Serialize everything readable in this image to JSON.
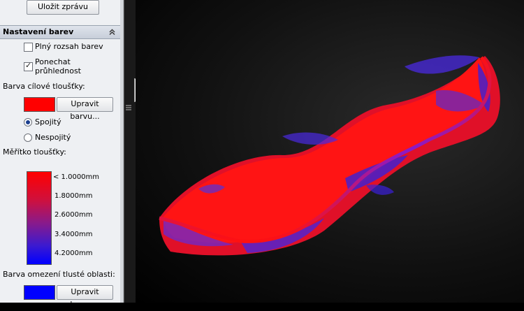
{
  "top_button": {
    "label": "Uložit zprávu"
  },
  "section": {
    "title": "Nastavení barev"
  },
  "options": {
    "full_range": {
      "label": "Plný rozsah barev",
      "checked": false
    },
    "keep_transparency": {
      "label_line1": "Ponechat",
      "label_line2": "průhlednost",
      "checked": true
    }
  },
  "target_color": {
    "label": "Barva cílové tloušťky:",
    "swatch": "#ff0000",
    "edit_button": "Upravit barvu..."
  },
  "mode": {
    "continuous": "Spojitý",
    "discrete": "Nespojitý",
    "selected": "continuous"
  },
  "scale": {
    "label": "Měřítko tloušťky:",
    "ticks": [
      "< 1.0000mm",
      "1.8000mm",
      "2.6000mm",
      "3.4000mm",
      "4.2000mm"
    ],
    "gradient_top": "#ff0000",
    "gradient_bottom": "#0000ff"
  },
  "thick_region": {
    "label": "Barva omezení tlusté oblasti:",
    "swatch": "#0000ff",
    "edit_button": "Upravit barvu..."
  },
  "model": {
    "primary_color": "#ff1010",
    "thick_color": "#3a2ad8"
  }
}
